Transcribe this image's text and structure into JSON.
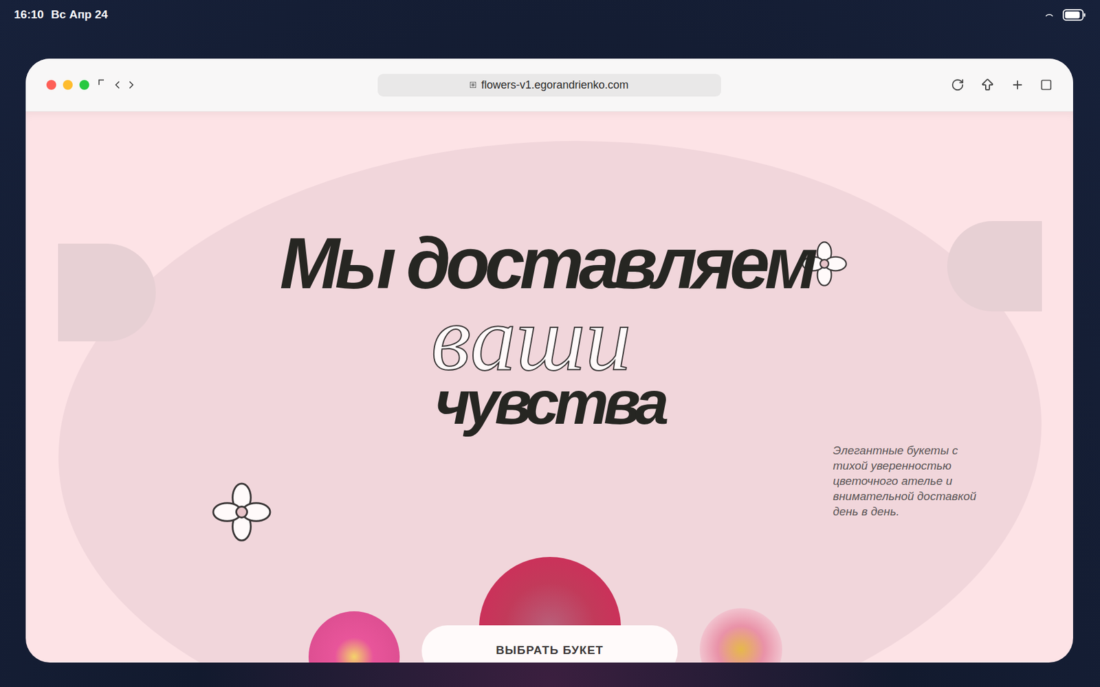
{
  "status_bar": {
    "time": "16:10",
    "date": "Вс Апр 24",
    "battery": {
      "level": 0.9
    }
  },
  "browser": {
    "url": "flowers-v1.egorandrienko.com"
  },
  "hero": {
    "title_line_1": "Мы доставляем",
    "title_line_2": "ваши",
    "title_line_3": "чувства",
    "description_lines": [
      "Элегантные букеты с",
      "тихой уверенностью",
      "цветочного ателье и",
      "внимательной доставкой",
      "день в день."
    ],
    "button": "ВЫБРАТЬ БУКЕТ"
  }
}
